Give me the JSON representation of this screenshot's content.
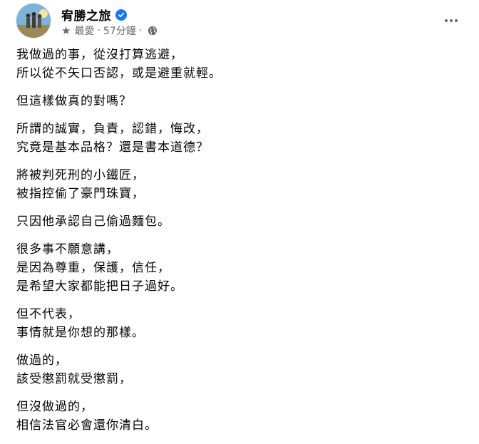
{
  "post": {
    "page_name": "宥勝之旅",
    "audience_label": "最愛",
    "time_ago": "57分鐘",
    "separator": "·",
    "icons": {
      "verified": "verified-badge-icon",
      "favorite": "star-icon",
      "privacy": "globe-icon",
      "more": "more-options-icon"
    },
    "accent_color": "#1877f2",
    "paragraphs": [
      [
        "我做過的事，從沒打算逃避，",
        "所以從不矢口否認，或是避重就輕。"
      ],
      [
        "但這樣做真的對嗎？"
      ],
      [
        "所謂的誠實，負責，認錯，悔改，",
        "究竟是基本品格？還是書本道德？"
      ],
      [
        "將被判死刑的小鐵匠，",
        "被指控偷了豪門珠寶，"
      ],
      [
        "只因他承認自己偷過麵包。"
      ],
      [
        "很多事不願意講，",
        "是因為尊重，保護，信任，",
        "是希望大家都能把日子過好。"
      ],
      [
        "但不代表，",
        "事情就是你想的那樣。"
      ],
      [
        "做過的，",
        "該受懲罰就受懲罰，"
      ],
      [
        "但沒做過的，",
        "相信法官必會還你清白。"
      ]
    ]
  }
}
